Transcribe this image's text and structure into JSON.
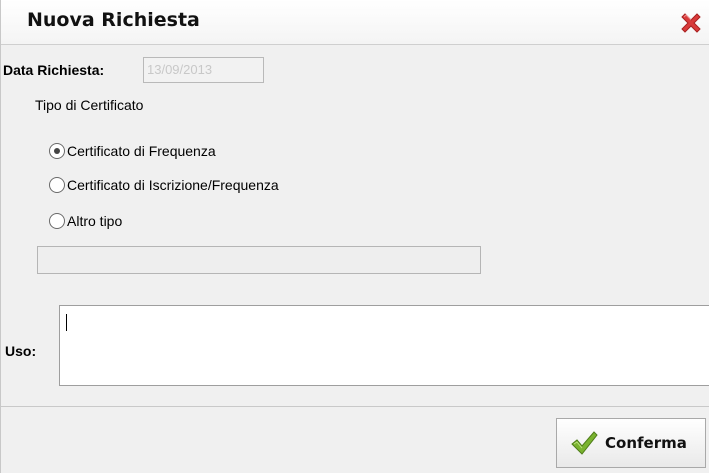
{
  "dialog": {
    "title": "Nuova Richiesta",
    "close_icon": "close-x-icon"
  },
  "form": {
    "date_label": "Data Richiesta:",
    "date_value": "13/09/2013",
    "certificate_type_label": "Tipo di Certificato",
    "options": [
      {
        "label": "Certificato di Frequenza",
        "checked": true
      },
      {
        "label": "Certificato di Iscrizione/Frequenza",
        "checked": false
      },
      {
        "label": "Altro tipo",
        "checked": false
      }
    ],
    "other_type_value": "",
    "uso_label": "Uso:",
    "uso_value": ""
  },
  "footer": {
    "confirm_label": "Conferma",
    "confirm_icon": "checkmark-icon"
  },
  "colors": {
    "close": "#d93a3a",
    "check": "#7ab32f"
  }
}
